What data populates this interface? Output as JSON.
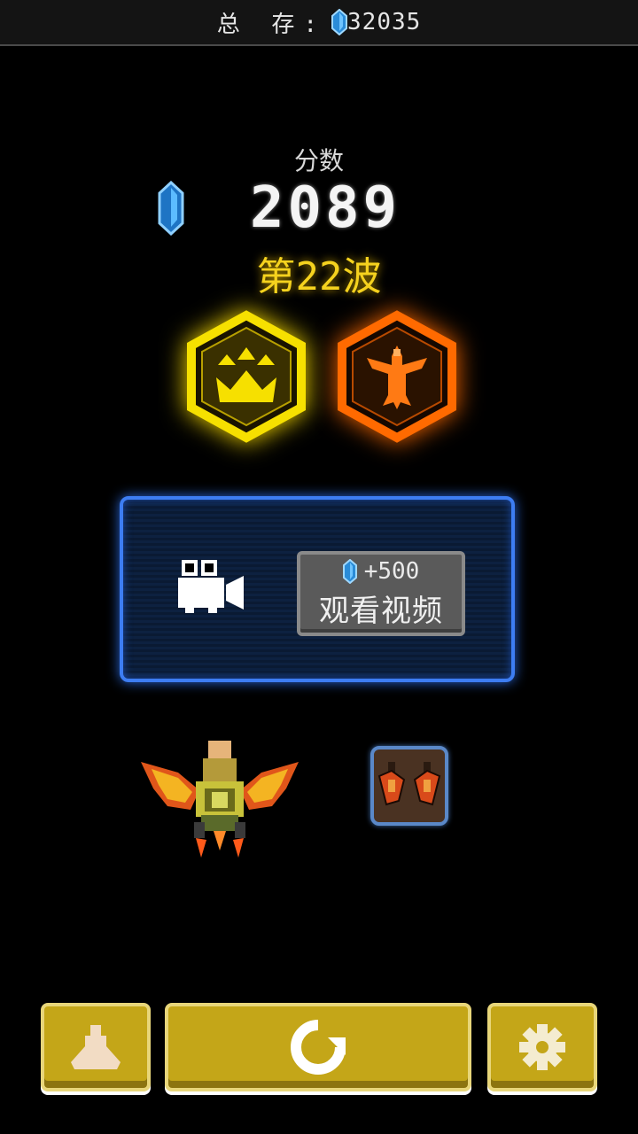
{
  "header": {
    "total_label": "总 存:",
    "total_value": "32035"
  },
  "score": {
    "label": "分数",
    "value": "2089",
    "wave": "第22波"
  },
  "medals": [
    {
      "name": "crown",
      "color": "#f6e000"
    },
    {
      "name": "eagle",
      "color": "#ff6a00"
    }
  ],
  "video_offer": {
    "reward": "+500",
    "button_label": "观看视频"
  },
  "colors": {
    "accent_blue": "#3d7df2",
    "button_gold": "#c4a618",
    "wave_yellow": "#f5d21e"
  },
  "bottom_bar": {
    "buttons": [
      {
        "icon": "ship-select-icon"
      },
      {
        "icon": "restart-icon"
      },
      {
        "icon": "settings-gear-icon"
      }
    ]
  }
}
